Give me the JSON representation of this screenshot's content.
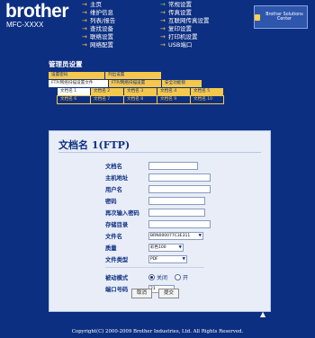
{
  "header": {
    "brand": "brother",
    "model": "MFC-XXXX",
    "nav_col1": [
      {
        "label": "主页",
        "arrow": "→"
      },
      {
        "label": "维护信息",
        "arrow": "→"
      },
      {
        "label": "列表/报告",
        "arrow": "→"
      },
      {
        "label": "查找设备",
        "arrow": "→"
      },
      {
        "label": "联络设置",
        "arrow": "→"
      },
      {
        "label": "网络配置",
        "arrow": "→"
      }
    ],
    "nav_col2": [
      {
        "label": "常规设置",
        "arrow": "→"
      },
      {
        "label": "传真设置",
        "arrow": "→"
      },
      {
        "label": "互联网传真设置",
        "arrow": "→"
      },
      {
        "label": "复印设置",
        "arrow": "→"
      },
      {
        "label": "打印机设置",
        "arrow": "→"
      },
      {
        "label": "USB端口",
        "arrow": "→"
      }
    ],
    "solutions": "Brother Solutions Center"
  },
  "admin": {
    "title": "管理员设置",
    "tabs_row1": [
      "设置密码",
      "列出设置"
    ],
    "tabs_row2": [
      "FTP/网络扫描设置文件",
      "FTP/网络扫描设置",
      "安全功能锁"
    ],
    "tabs_row3": [
      "文档名 1",
      "文档名 2",
      "文档名 3",
      "文档名 4",
      "文档名 5"
    ],
    "tabs_row4": [
      "文档名 6",
      "文档名 7",
      "文档名 8",
      "文档名 9",
      "文档名 10"
    ]
  },
  "form": {
    "title": "文档名 1(FTP)",
    "fields": {
      "doc_name_label": "文档名",
      "host_label": "主机地址",
      "user_label": "用户名",
      "password_label": "密码",
      "password_confirm_label": "再次输入密码",
      "store_dir_label": "存储目录",
      "filename_label": "文件名",
      "filename_value": "BRN000077C3E311",
      "quality_label": "质量",
      "quality_value": "彩色100",
      "filetype_label": "文件类型",
      "filetype_value": "PDF",
      "passive_label": "被动模式",
      "passive_off": "关闭",
      "passive_on": "开",
      "port_label": "端口号码",
      "port_value": "21"
    },
    "cancel": "取消",
    "submit": "提交"
  },
  "footer": "Copyright(C) 2000-2009 Brother Industries, Ltd. All Rights Reserved."
}
